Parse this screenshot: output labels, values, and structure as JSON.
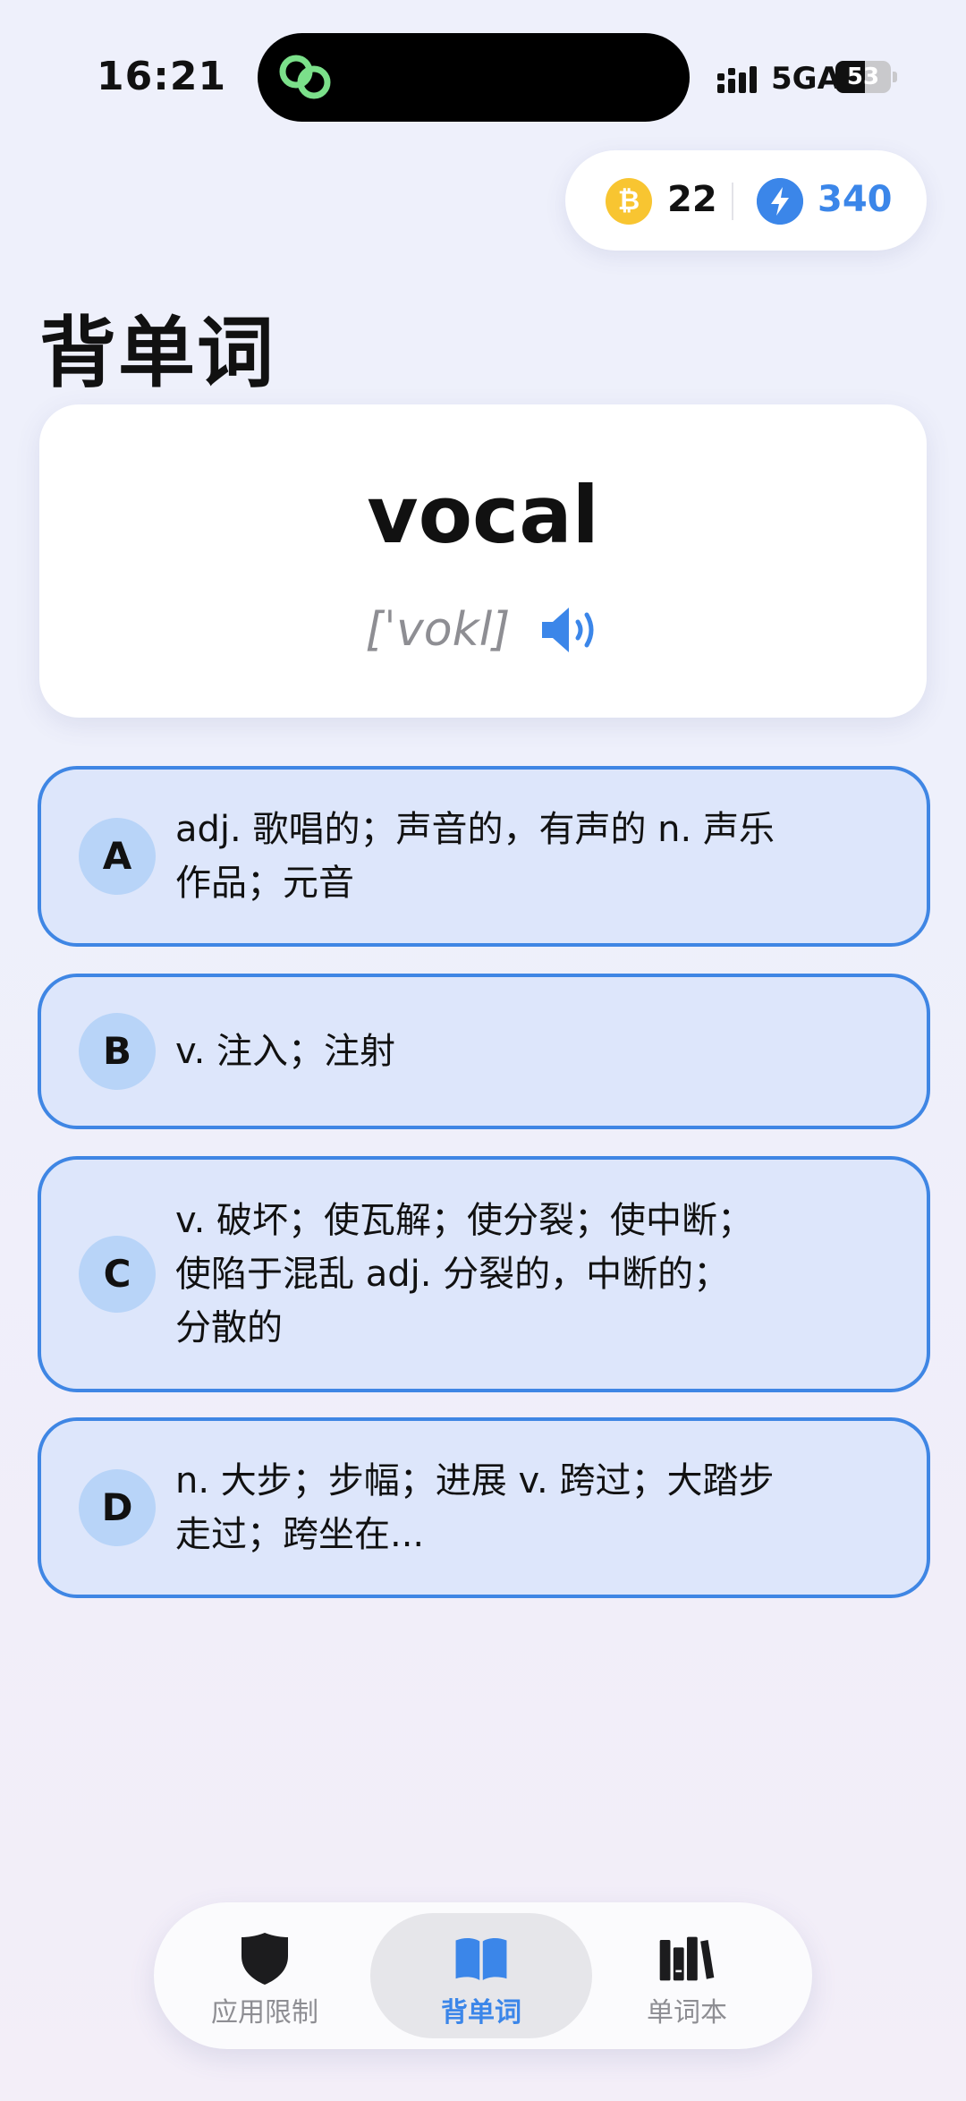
{
  "status_bar": {
    "time": "16:21",
    "network": "5GA",
    "battery_level": "53"
  },
  "stats": {
    "coin_symbol": "₿",
    "coins": "22",
    "energy": "340"
  },
  "page_title": "背单词",
  "word_card": {
    "word": "vocal",
    "phonetic": "[ˈvokl]"
  },
  "options": [
    {
      "letter": "A",
      "text": "adj. 歌唱的；声音的，有声的  n. 声乐\n作品；元音"
    },
    {
      "letter": "B",
      "text": "v. 注入；注射"
    },
    {
      "letter": "C",
      "text": "v. 破坏；使瓦解；使分裂；使中断；\n使陷于混乱  adj. 分裂的，中断的；\n分散的"
    },
    {
      "letter": "D",
      "text": "n. 大步；步幅；进展  v. 跨过；大踏步\n走过；跨坐在..."
    }
  ],
  "tabs": [
    {
      "label": "应用限制",
      "icon": "shield-icon"
    },
    {
      "label": "背单词",
      "icon": "open-book-icon",
      "active": true
    },
    {
      "label": "单词本",
      "icon": "books-icon"
    }
  ],
  "colors": {
    "accent": "#3b86e9",
    "option_bg": "#dde6fb",
    "option_border": "#3f86e4",
    "coin": "#f8c531"
  }
}
